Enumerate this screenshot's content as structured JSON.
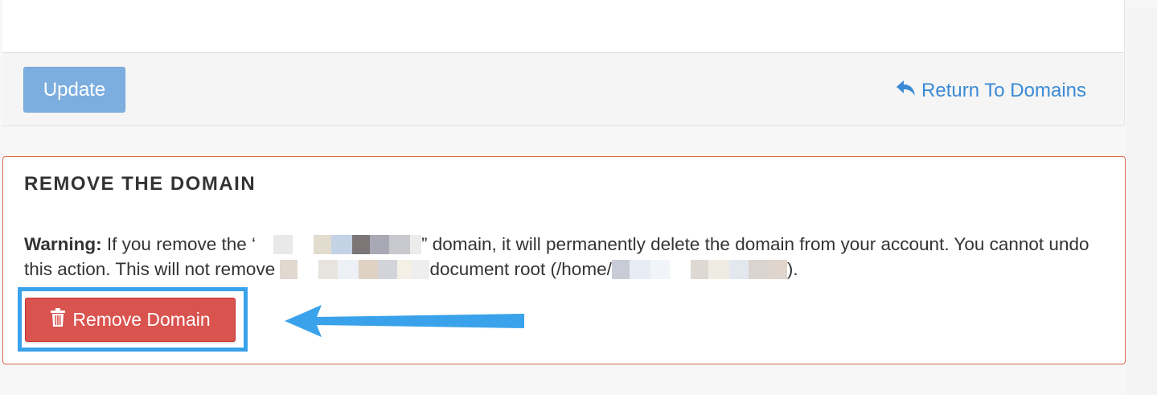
{
  "form_footer": {
    "update_label": "Update",
    "return_label": "Return To Domains",
    "return_icon": "reply-icon"
  },
  "remove_section": {
    "title": "REMOVE THE DOMAIN",
    "warning_label": "Warning:",
    "warning_part1": " If you remove the ‘",
    "warning_part2": "” domain, it will permanently delete the domain from your account. You cannot undo this action. This will not remove ",
    "warning_part3": "document root (/home/",
    "warning_part4": ").",
    "button_label": "Remove Domain",
    "button_icon": "trash-icon"
  },
  "colors": {
    "update_button": "#7daee0",
    "link": "#3a8ad6",
    "danger_border": "#d9694a",
    "danger_button": "#d9534f",
    "annotation": "#3aa2ea"
  }
}
